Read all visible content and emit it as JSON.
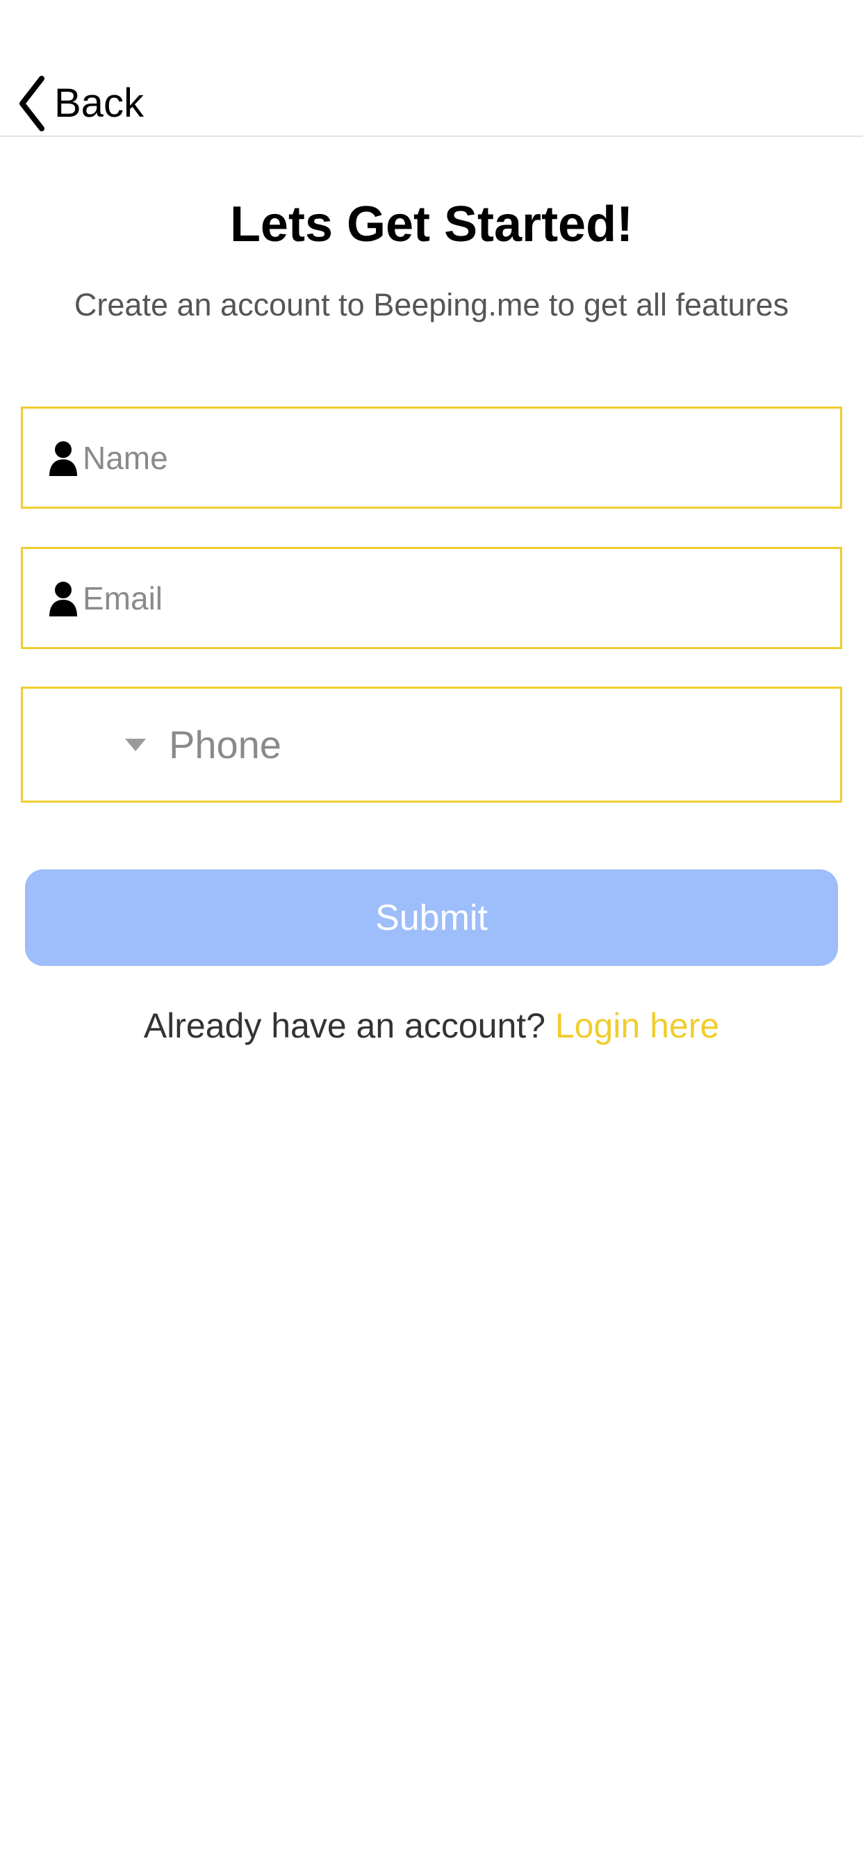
{
  "nav": {
    "back_label": "Back"
  },
  "header": {
    "title": "Lets Get Started!",
    "subtitle": "Create an account to Beeping.me to get all features"
  },
  "form": {
    "name": {
      "placeholder": "Name",
      "value": "",
      "icon": "person-icon"
    },
    "email": {
      "placeholder": "Email",
      "value": "",
      "icon": "person-icon"
    },
    "phone": {
      "placeholder": "Phone",
      "value": "",
      "icon": "caret-down-icon"
    },
    "submit_label": "Submit"
  },
  "footer": {
    "prompt": "Already have an account? ",
    "login_link": "Login here"
  },
  "colors": {
    "accent_yellow": "#f0cd2e",
    "submit_disabled_blue": "#9dbdfb",
    "text_primary": "#000000",
    "text_secondary": "#555555"
  }
}
